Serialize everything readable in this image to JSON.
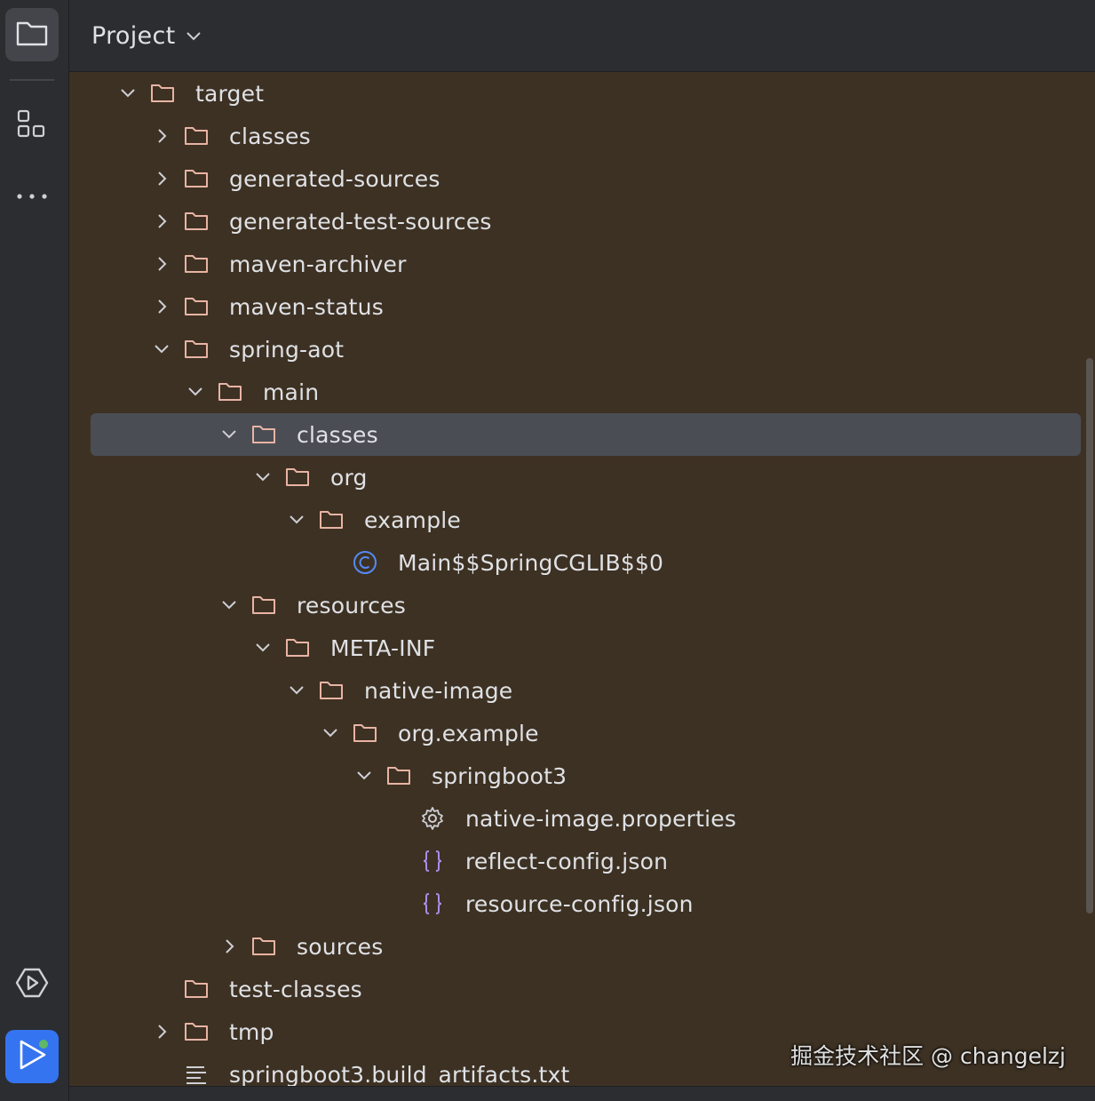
{
  "header": {
    "title": "Project"
  },
  "stripe": {
    "top_icons": [
      "folder-icon",
      "structure-icon",
      "more-icon"
    ],
    "bottom_icons": [
      "services-icon",
      "run-icon"
    ]
  },
  "tree": {
    "target": "target",
    "target_classes": "classes",
    "generated_sources": "generated-sources",
    "generated_test_sources": "generated-test-sources",
    "maven_archiver": "maven-archiver",
    "maven_status": "maven-status",
    "spring_aot": "spring-aot",
    "main": "main",
    "main_classes": "classes",
    "org": "org",
    "example": "example",
    "main_class": "Main$$SpringCGLIB$$0",
    "resources": "resources",
    "meta_inf": "META-INF",
    "native_image": "native-image",
    "org_example": "org.example",
    "springboot3": "springboot3",
    "native_image_properties": "native-image.properties",
    "reflect_config": "reflect-config.json",
    "resource_config": "resource-config.json",
    "sources": "sources",
    "test_classes": "test-classes",
    "tmp": "tmp",
    "build_artifacts": "springboot3.build_artifacts.txt"
  },
  "watermark": "掘金技术社区 @ changelzj",
  "colors": {
    "panel_bg": "#3d3123",
    "selection": "#4b4d55",
    "folder_icon": "#e8b4a4",
    "class_icon": "#548af7",
    "json_icon": "#a88ee8",
    "run_button": "#3574f0"
  }
}
